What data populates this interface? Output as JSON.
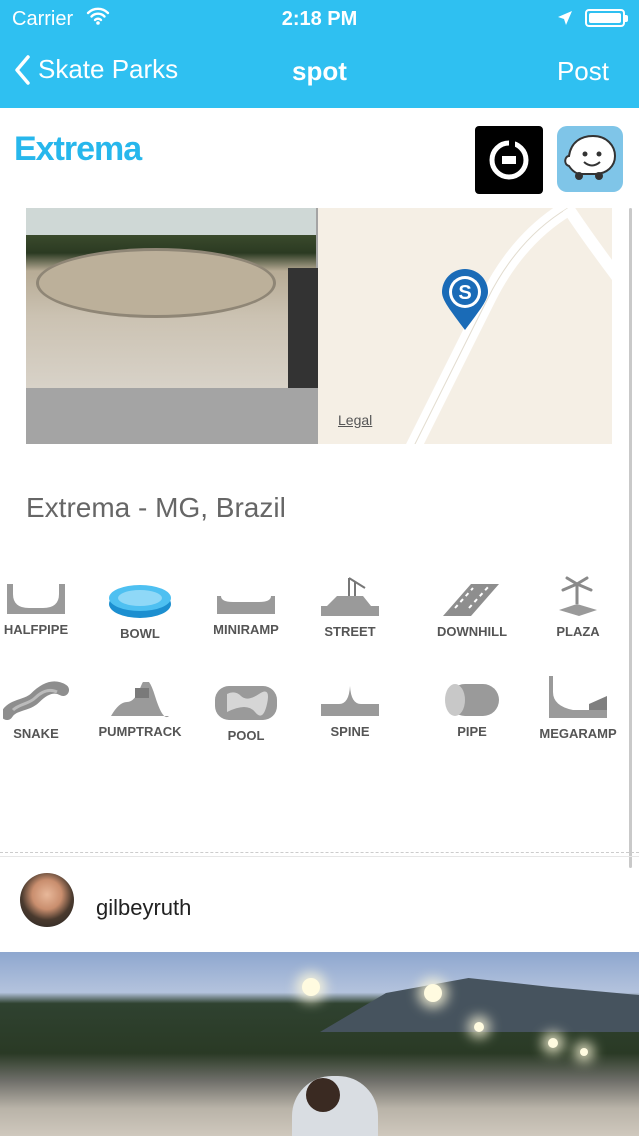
{
  "status_bar": {
    "carrier": "Carrier",
    "time": "2:18 PM"
  },
  "nav": {
    "back_label": "Skate Parks",
    "title": "spot",
    "post_label": "Post"
  },
  "spot": {
    "name": "Extrema",
    "address": "Extrema - MG, Brazil"
  },
  "map": {
    "legal_label": "Legal",
    "pin_letter": "S"
  },
  "apps": {
    "uber_icon": "uber-icon",
    "waze_icon": "waze-icon"
  },
  "park_types": [
    {
      "label": "HALFPIPE"
    },
    {
      "label": "BOWL"
    },
    {
      "label": "MINIRAMP"
    },
    {
      "label": "STREET"
    },
    {
      "label": "DOWNHILL"
    },
    {
      "label": "PLAZA"
    },
    {
      "label": "SNAKE"
    },
    {
      "label": "PUMPTRACK"
    },
    {
      "label": "POOL"
    },
    {
      "label": "SPINE"
    },
    {
      "label": "PIPE"
    },
    {
      "label": "MEGARAMP"
    }
  ],
  "post": {
    "username": "gilbeyruth"
  },
  "colors": {
    "accent": "#2fc0f1",
    "brand_text": "#27b7ec",
    "active_type": "#38b6ee"
  }
}
